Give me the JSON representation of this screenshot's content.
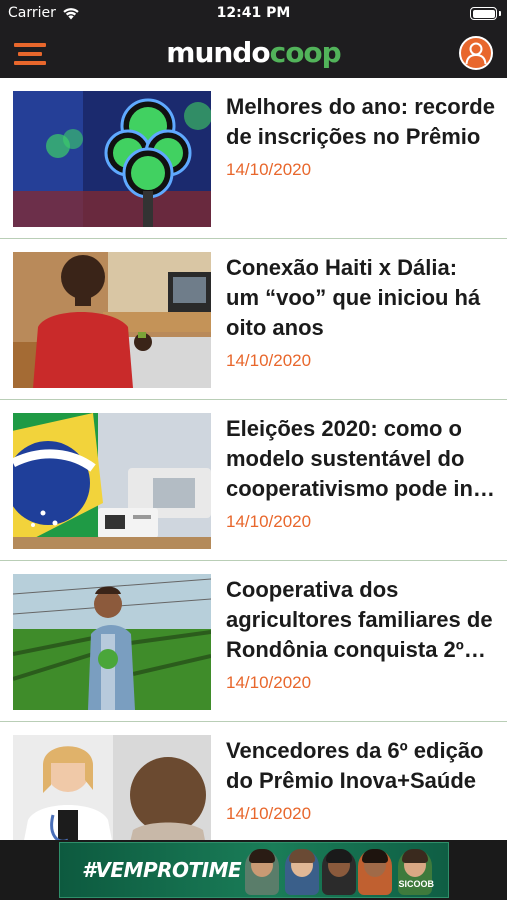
{
  "status_bar": {
    "carrier": "Carrier",
    "time": "12:41 PM"
  },
  "header": {
    "logo_white": "mundo",
    "logo_green": "coop",
    "menu_icon": "hamburger-menu-icon",
    "profile_icon": "user-profile-icon"
  },
  "colors": {
    "accent": "#e8672c",
    "brand_green": "#52b35a",
    "header_bg": "#1e1d1f",
    "divider": "#b9ceb6"
  },
  "articles": [
    {
      "title": "Melhores do ano: recorde de inscrições no Prêmio",
      "date": "14/10/2020",
      "image": "trophy-award-photo"
    },
    {
      "title": "Conexão Haiti x Dália: um “voo” que iniciou há oito anos",
      "date": "14/10/2020",
      "image": "man-with-chimarrao-photo"
    },
    {
      "title": "Eleições 2020: como o modelo sustentável do cooperativismo pode in…",
      "date": "14/10/2020",
      "image": "ballot-box-flag-photo"
    },
    {
      "title": "Cooperativa dos agricultores familiares de Rondônia conquista 2º l…",
      "date": "14/10/2020",
      "image": "farmer-greenhouse-photo"
    },
    {
      "title": "Vencedores da 6º edição do Prêmio Inova+Saúde",
      "date": "14/10/2020",
      "image": "doctor-photo"
    }
  ],
  "banner": {
    "text": "#VEMPROTIME",
    "brand": "SICOOB"
  }
}
